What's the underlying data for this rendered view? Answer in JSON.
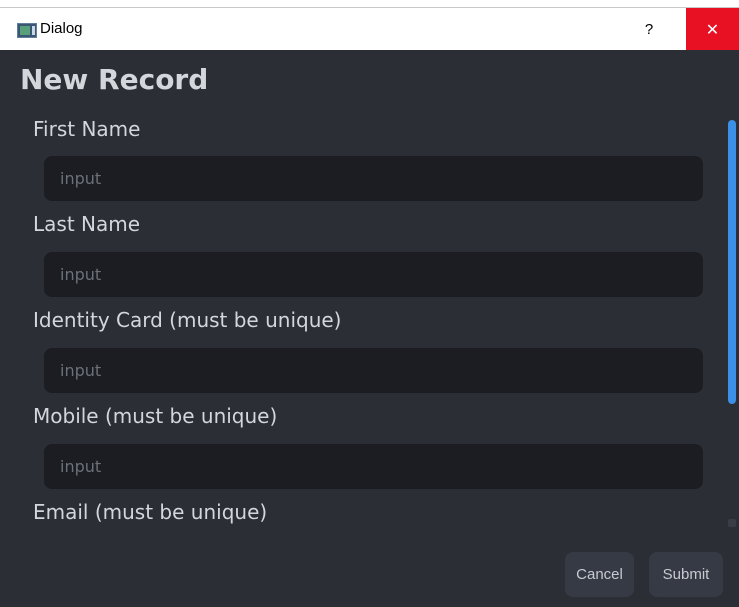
{
  "window": {
    "title": "Dialog",
    "help_label": "?",
    "close_label": "✕",
    "close_color": "#e81123"
  },
  "form": {
    "title": "New Record",
    "fields": [
      {
        "label": "First Name",
        "placeholder": "input"
      },
      {
        "label": "Last Name",
        "placeholder": "input"
      },
      {
        "label": "Identity Card (must be unique)",
        "placeholder": "input"
      },
      {
        "label": "Mobile (must be unique)",
        "placeholder": "input"
      },
      {
        "label": "Email (must be unique)"
      }
    ]
  },
  "actions": {
    "cancel_label": "Cancel",
    "submit_label": "Submit"
  },
  "colors": {
    "background": "#2b2e35",
    "input_background": "#1c1d22",
    "scroll_accent": "#3b8fe6"
  }
}
